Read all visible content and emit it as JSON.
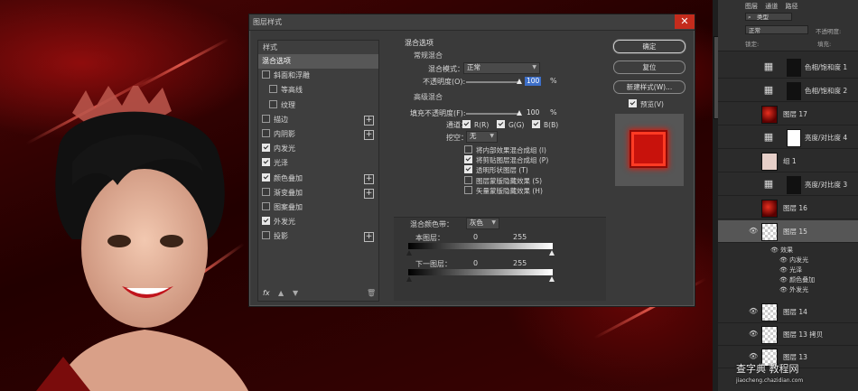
{
  "dialog": {
    "title": "图层样式",
    "sidebar": {
      "header": "样式",
      "items": [
        {
          "label": "混合选项",
          "checkbox": false,
          "checked": false,
          "selected": true,
          "plus": false,
          "indent": false
        },
        {
          "label": "斜面和浮雕",
          "checkbox": true,
          "checked": false,
          "selected": false,
          "plus": false,
          "indent": false
        },
        {
          "label": "等高线",
          "checkbox": true,
          "checked": false,
          "selected": false,
          "plus": false,
          "indent": true
        },
        {
          "label": "纹理",
          "checkbox": true,
          "checked": false,
          "selected": false,
          "plus": false,
          "indent": true
        },
        {
          "label": "描边",
          "checkbox": true,
          "checked": false,
          "selected": false,
          "plus": true,
          "indent": false
        },
        {
          "label": "内阴影",
          "checkbox": true,
          "checked": false,
          "selected": false,
          "plus": true,
          "indent": false
        },
        {
          "label": "内发光",
          "checkbox": true,
          "checked": true,
          "selected": false,
          "plus": false,
          "indent": false
        },
        {
          "label": "光泽",
          "checkbox": true,
          "checked": true,
          "selected": false,
          "plus": false,
          "indent": false
        },
        {
          "label": "颜色叠加",
          "checkbox": true,
          "checked": true,
          "selected": false,
          "plus": true,
          "indent": false
        },
        {
          "label": "渐变叠加",
          "checkbox": true,
          "checked": false,
          "selected": false,
          "plus": true,
          "indent": false
        },
        {
          "label": "图案叠加",
          "checkbox": true,
          "checked": false,
          "selected": false,
          "plus": false,
          "indent": false
        },
        {
          "label": "外发光",
          "checkbox": true,
          "checked": true,
          "selected": false,
          "plus": false,
          "indent": false
        },
        {
          "label": "投影",
          "checkbox": true,
          "checked": false,
          "selected": false,
          "plus": true,
          "indent": false
        }
      ],
      "footer_fx": "fx"
    },
    "blend_options": {
      "heading": "混合选项",
      "general_heading": "常规混合",
      "blend_mode_label": "混合模式：",
      "blend_mode_value": "正常",
      "opacity_label": "不透明度(O):",
      "opacity_value": "100",
      "opacity_unit": "%",
      "advanced_heading": "高级混合",
      "fill_opacity_label": "填充不透明度(F):",
      "fill_opacity_value": "100",
      "fill_unit": "%",
      "channels_label": "通道：",
      "channel_r": "R(R)",
      "channel_g": "G(G)",
      "channel_b": "B(B)",
      "knockout_label": "挖空：",
      "knockout_value": "无",
      "options": [
        {
          "label": "将内部效果混合成组 (I)",
          "checked": false
        },
        {
          "label": "将剪贴图层混合成组 (P)",
          "checked": true
        },
        {
          "label": "透明形状图层 (T)",
          "checked": true
        },
        {
          "label": "图层蒙版隐藏效果 (S)",
          "checked": false
        },
        {
          "label": "矢量蒙版隐藏效果 (H)",
          "checked": false
        }
      ],
      "blend_if_label": "混合颜色带：",
      "blend_if_value": "灰色",
      "this_layer_label": "本图层：",
      "this_layer_min": "0",
      "this_layer_max": "255",
      "underlying_label": "下一图层：",
      "underlying_min": "0",
      "underlying_max": "255"
    },
    "buttons": {
      "ok": "确定",
      "reset": "复位",
      "new_style": "新建样式(W)...",
      "preview": "预览(V)",
      "preview_checked": true
    }
  },
  "layers": {
    "top_search": "类型",
    "blend_mode": "正常",
    "opacity_label": "不透明度:",
    "lock_label": "锁定:",
    "fill_label": "填充:",
    "header_tabs": [
      "图层",
      "通道",
      "路径"
    ],
    "items": [
      {
        "name": "色相/饱和度 1",
        "type": "adj",
        "mask": "dark",
        "selected": false,
        "eye": false
      },
      {
        "name": "色相/饱和度 2",
        "type": "adj",
        "mask": "dark",
        "selected": false,
        "eye": false
      },
      {
        "name": "图层 17",
        "type": "red",
        "mask": "",
        "selected": false,
        "eye": false
      },
      {
        "name": "亮度/对比度 4",
        "type": "adj",
        "mask": "white",
        "selected": false,
        "eye": false
      },
      {
        "name": "组 1",
        "type": "group",
        "mask": "",
        "selected": false,
        "eye": false
      },
      {
        "name": "亮度/对比度 3",
        "type": "adj",
        "mask": "dark",
        "selected": false,
        "eye": false
      },
      {
        "name": "图层 16",
        "type": "red",
        "mask": "",
        "selected": false,
        "eye": false
      },
      {
        "name": "图层 15",
        "type": "trans",
        "mask": "",
        "selected": true,
        "eye": true
      }
    ],
    "effects_label": "效果",
    "effects": [
      "内发光",
      "光泽",
      "颜色叠加",
      "外发光"
    ],
    "lower_items": [
      {
        "name": "图层 14",
        "eye": true
      },
      {
        "name": "图层 13 拷贝",
        "eye": true
      },
      {
        "name": "图层 13",
        "eye": true
      }
    ]
  },
  "watermark": {
    "main": "查字典 教程网",
    "sub": "jiaocheng.chazidian.com"
  }
}
